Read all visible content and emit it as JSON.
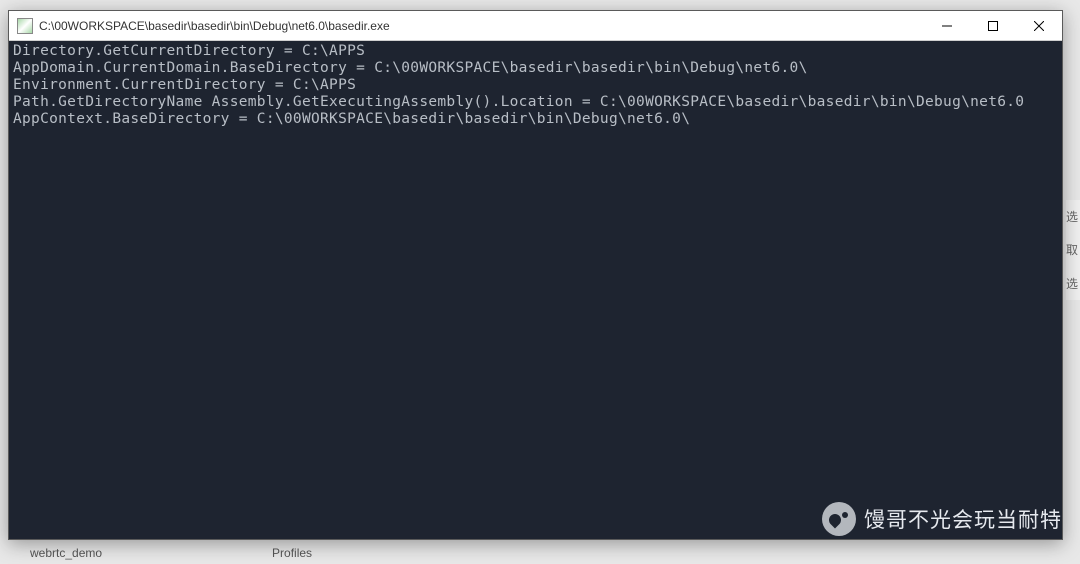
{
  "window": {
    "title": "C:\\00WORKSPACE\\basedir\\basedir\\bin\\Debug\\net6.0\\basedir.exe"
  },
  "console": {
    "lines": [
      "Directory.GetCurrentDirectory = C:\\APPS",
      "AppDomain.CurrentDomain.BaseDirectory = C:\\00WORKSPACE\\basedir\\basedir\\bin\\Debug\\net6.0\\",
      "Environment.CurrentDirectory = C:\\APPS",
      "Path.GetDirectoryName Assembly.GetExecutingAssembly().Location = C:\\00WORKSPACE\\basedir\\basedir\\bin\\Debug\\net6.0",
      "AppContext.BaseDirectory = C:\\00WORKSPACE\\basedir\\basedir\\bin\\Debug\\net6.0\\"
    ]
  },
  "watermark": {
    "text": "馒哥不光会玩当耐特"
  },
  "background": {
    "taskbar_item1": "webrtc_demo",
    "taskbar_item2": "Profiles",
    "side_char1": "选",
    "side_char2": "取",
    "side_char3": "选"
  }
}
